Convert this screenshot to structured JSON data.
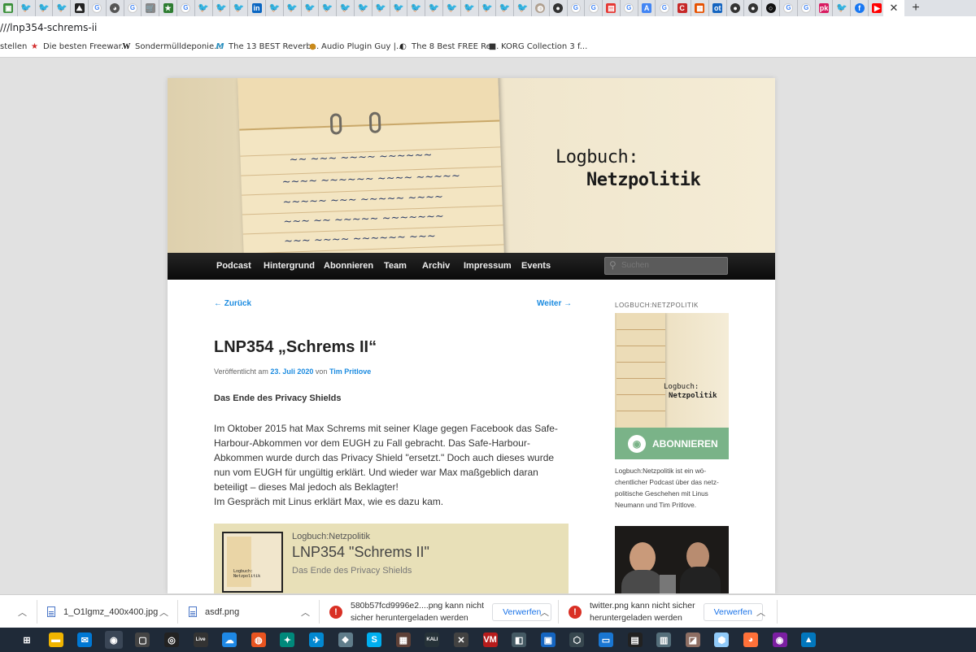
{
  "browser": {
    "tab_favicons": [
      "pg",
      "tw",
      "tw",
      "tw",
      "mt",
      "G",
      "dn",
      "G",
      "cart",
      "star",
      "G",
      "tw",
      "tw",
      "tw",
      "in",
      "tw",
      "tw",
      "tw",
      "tw",
      "tw",
      "tw",
      "tw",
      "tw",
      "tw",
      "tw",
      "tw",
      "tw",
      "tw",
      "tw",
      "tw",
      "pt",
      "gh",
      "G",
      "G",
      "nb",
      "G",
      "gt",
      "G",
      "C",
      "fc",
      "ot",
      "gh",
      "gh",
      "ci",
      "G",
      "G",
      "pk",
      "tw",
      "fb",
      "yt"
    ],
    "active_tab_close": "✕",
    "new_tab": "+",
    "url": "///lnp354-schrems-ii",
    "bookmarks": [
      {
        "label": "stellen",
        "icon": ""
      },
      {
        "label": "Die besten Freewar...",
        "icon": "★"
      },
      {
        "label": "Sondermülldeponie...",
        "icon": "W"
      },
      {
        "label": "The 13 BEST Reverb...",
        "icon": "M"
      },
      {
        "label": "Audio Plugin Guy |...",
        "icon": "●"
      },
      {
        "label": "The 8 Best FREE Re...",
        "icon": "◐"
      },
      {
        "label": "KORG Collection 3 f...",
        "icon": "■"
      }
    ]
  },
  "site": {
    "logo_line1": "Logbuch:",
    "logo_line2": "Netzpolitik",
    "nav": [
      "Podcast",
      "Hintergrund",
      "Abonnieren",
      "Team",
      "Archiv",
      "Impressum",
      "Events"
    ],
    "search_placeholder": "Suchen"
  },
  "post": {
    "prev": "← Zurück",
    "next": "Weiter →",
    "title": "LNP354 „Schrems II“",
    "meta_prefix": "Veröffentlicht am ",
    "date": "23. Juli 2020",
    "meta_by": " von ",
    "author": "Tim Pritlove",
    "subtitle": "Das Ende des Privacy Shields",
    "body1": "Im Oktober 2015 hat Max Schrems mit seiner Klage gegen Facebook das Safe-Harbour-Abkommen vor dem EUGH zu Fall gebracht. Das Safe-Harbour-Abkommen wurde durch das Privacy Shield \"ersetzt.\" Doch auch dieses wurde nun vom EUGH für ungültig erklärt. Und wieder war Max maßgeblich daran beteiligt – dieses Mal jedoch als Beklagter!",
    "body2": "Im Gespräch mit Linus erklärt Max, wie es dazu kam."
  },
  "player": {
    "show": "Logbuch:Netzpolitik",
    "episode": "LNP354 \"Schrems II\"",
    "subtitle": "Das Ende des Privacy Shields",
    "cover_logo": "Logbuch:\nNetzpolitik"
  },
  "sidebar": {
    "title": "LOGBUCH:NETZPOLITIK",
    "cover_logo1": "Logbuch:",
    "cover_logo2": "Netzpolitik",
    "subscribe": "ABONNIEREN",
    "description": "Logbuch:Netzpolitik ist ein wö­chentlicher Podcast über das netz­politische Geschehen mit Linus Neumann und Tim Pritlove."
  },
  "downloads": [
    {
      "file": "1_O1lgmz_400x400.jpg",
      "type": "file"
    },
    {
      "file": "asdf.png",
      "type": "file"
    },
    {
      "line1": "580b57fcd9996e2....png kann nicht",
      "line2": "sicher heruntergeladen werden",
      "button": "Verwerfen",
      "type": "warning"
    },
    {
      "line1": "twitter.png kann nicht sicher",
      "line2": "heruntergeladen werden",
      "button": "Verwerfen",
      "type": "warning"
    }
  ],
  "taskbar": [
    "start",
    "files",
    "mail",
    "chrome",
    "app",
    "obs",
    "live",
    "app2",
    "ubuntu",
    "app3",
    "app4",
    "app5",
    "skype",
    "app6",
    "kali",
    "app7",
    "voicemeeter",
    "app8",
    "app9",
    "app10",
    "app11",
    "app12",
    "app13",
    "app14",
    "app15",
    "firefox",
    "app16",
    "app17"
  ],
  "colors": {
    "link": "#1b8be0",
    "subscribe": "#7ab388",
    "player_bg": "#e8e0b8",
    "twitter": "#1da1f2",
    "warning": "#d93025"
  }
}
